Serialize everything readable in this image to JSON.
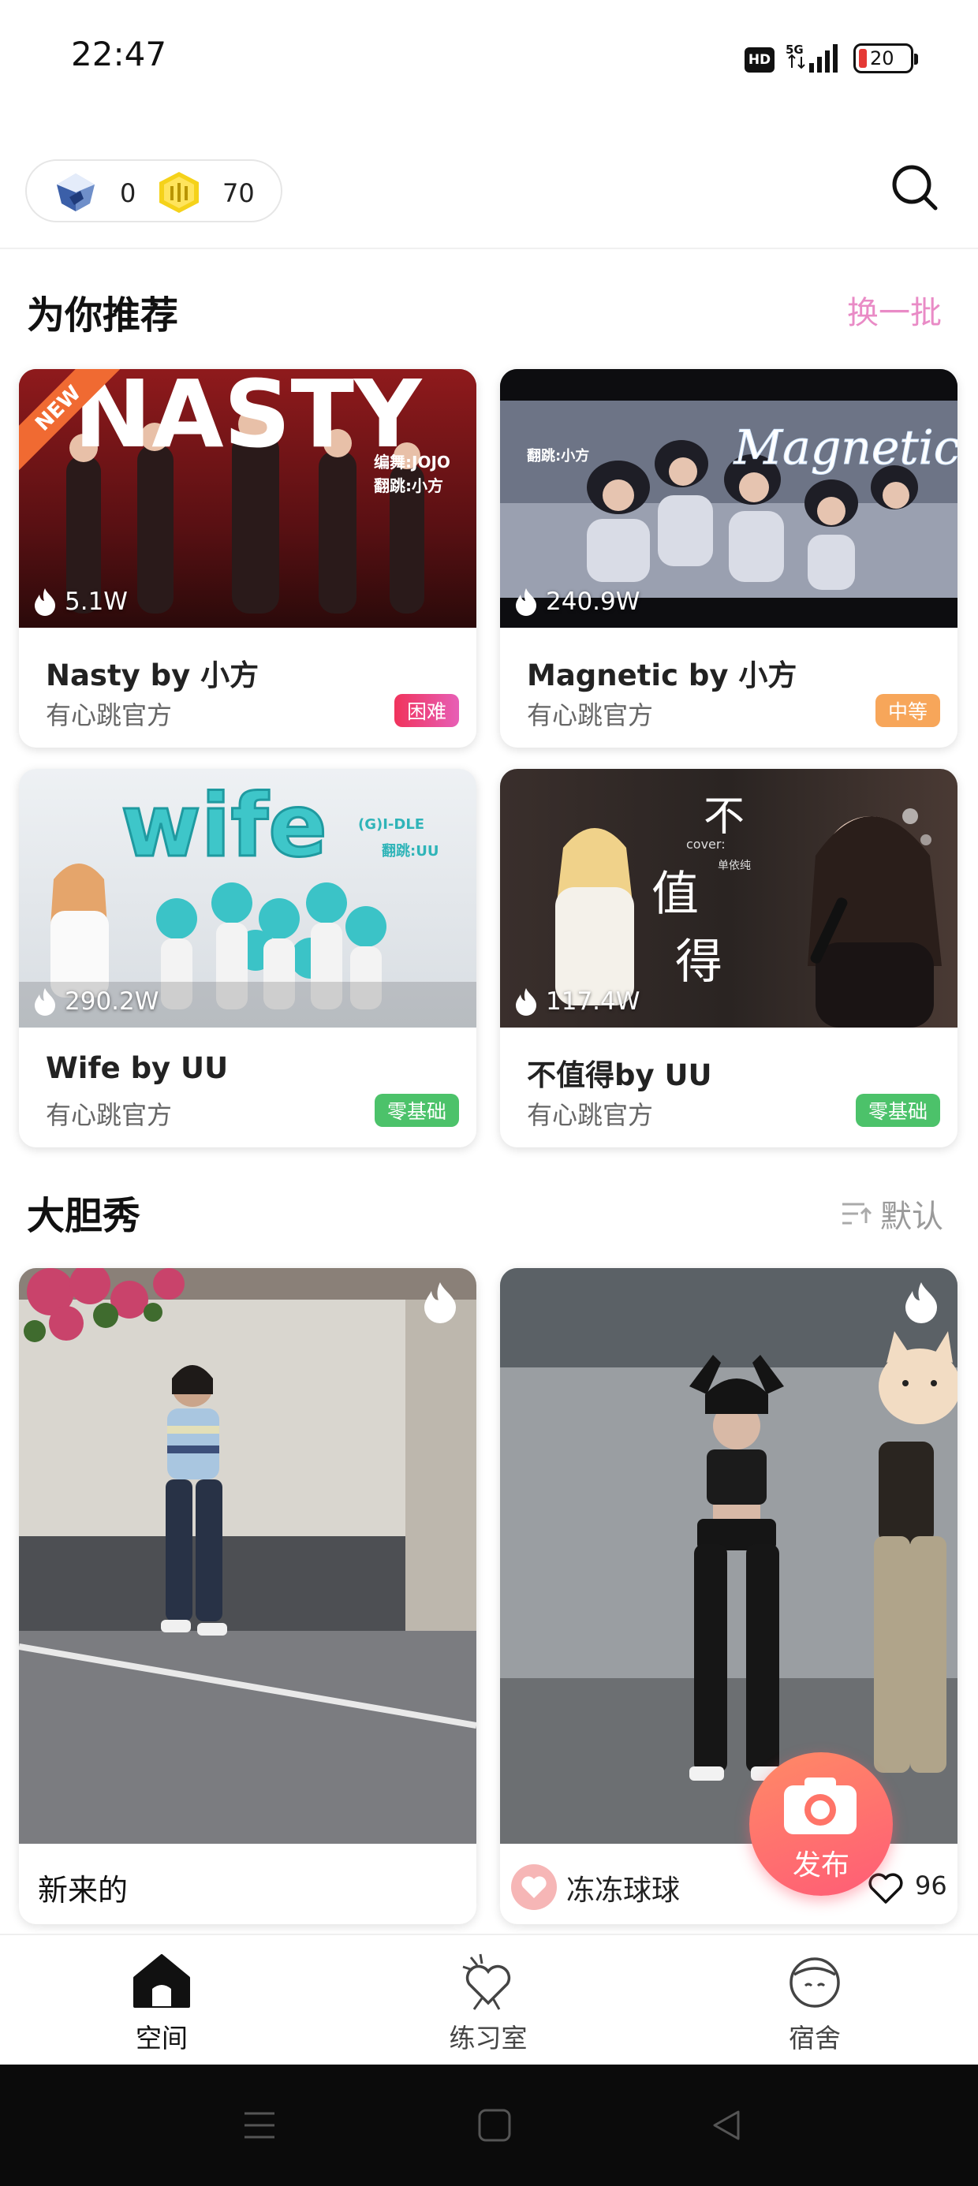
{
  "status_bar": {
    "time": "22:47",
    "hd": "HD",
    "network": "5G",
    "battery": "20"
  },
  "wallet": {
    "gem_count": "0",
    "coin_count": "70"
  },
  "recommend": {
    "title": "为你推荐",
    "refresh_label": "换一批",
    "cards": [
      {
        "title": "Nasty by 小方",
        "author": "有心跳官方",
        "views": "5.1W",
        "level": "困难",
        "thumb_text": "NASTY",
        "thumb_credit_1": "编舞:JOJO",
        "thumb_credit_2": "翻跳:小方",
        "ribbon": "NEW"
      },
      {
        "title": "Magnetic by 小方",
        "author": "有心跳官方",
        "views": "240.9W",
        "level": "中等",
        "thumb_text": "Magnetic",
        "thumb_credit_1": "翻跳:小方"
      },
      {
        "title": "Wife by UU",
        "author": "有心跳官方",
        "views": "290.2W",
        "level": "零基础",
        "thumb_text": "wife",
        "thumb_credit_1": "(G)I-DLE",
        "thumb_credit_2": "翻跳:UU"
      },
      {
        "title": "不值得by UU",
        "author": "有心跳官方",
        "views": "117.4W",
        "level": "零基础",
        "thumb_text_1": "不",
        "thumb_text_2": "值",
        "thumb_text_3": "得",
        "thumb_cover": "cover:",
        "thumb_singer": "单依纯"
      }
    ]
  },
  "show": {
    "title": "大胆秀",
    "sort_label": "默认",
    "cards": [
      {
        "caption": "新来的"
      },
      {
        "user": "冻冻球球",
        "likes": "96"
      }
    ]
  },
  "publish": {
    "label": "发布"
  },
  "tabs": [
    {
      "label": "空间",
      "active": true
    },
    {
      "label": "练习室",
      "active": false
    },
    {
      "label": "宿舍",
      "active": false
    }
  ],
  "colors": {
    "accent_pink": "#e98bc6",
    "level_hard": "#ec3f7a",
    "level_medium": "#f7a65a",
    "level_beginner": "#4cc26a",
    "publish": "#ff6a72"
  }
}
